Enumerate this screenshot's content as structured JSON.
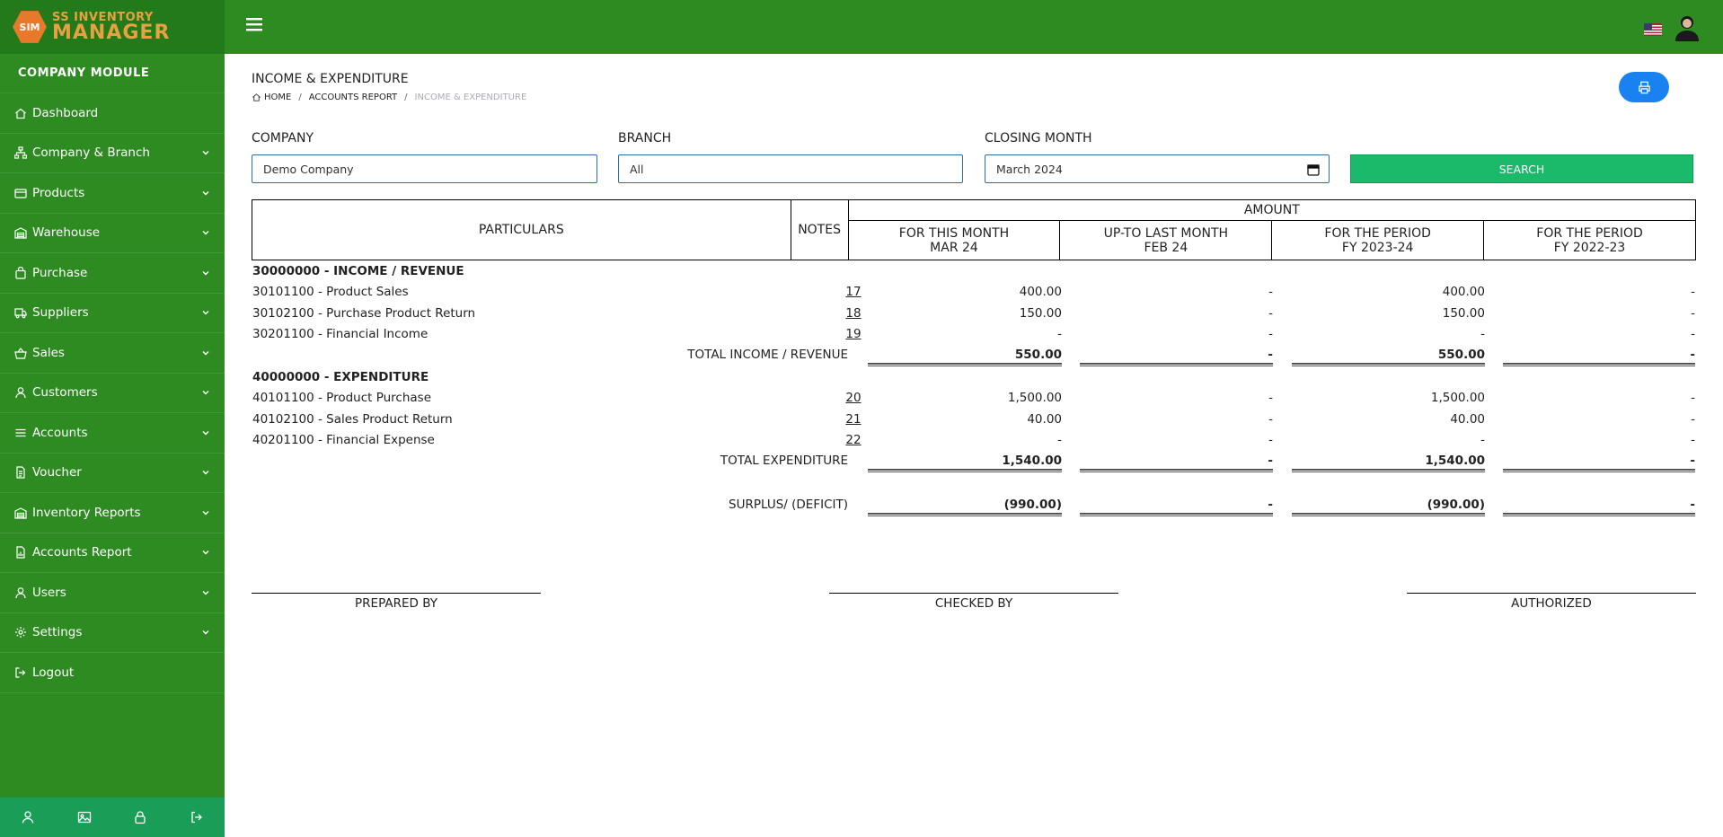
{
  "brand": {
    "logo_badge": "SIM",
    "line1": "SS INVENTORY",
    "line2": "MANAGER"
  },
  "sidebar": {
    "module_title": "COMPANY MODULE",
    "items": [
      {
        "label": "Dashboard",
        "icon": "home-icon",
        "chevron": false
      },
      {
        "label": "Company & Branch",
        "icon": "sitemap-icon",
        "chevron": true
      },
      {
        "label": "Products",
        "icon": "box-icon",
        "chevron": true
      },
      {
        "label": "Warehouse",
        "icon": "warehouse-icon",
        "chevron": true
      },
      {
        "label": "Purchase",
        "icon": "bag-icon",
        "chevron": true
      },
      {
        "label": "Suppliers",
        "icon": "truck-icon",
        "chevron": true
      },
      {
        "label": "Sales",
        "icon": "basket-icon",
        "chevron": true
      },
      {
        "label": "Customers",
        "icon": "user-icon",
        "chevron": true
      },
      {
        "label": "Accounts",
        "icon": "list-icon",
        "chevron": true
      },
      {
        "label": "Voucher",
        "icon": "file-icon",
        "chevron": true
      },
      {
        "label": "Inventory Reports",
        "icon": "warehouse-icon",
        "chevron": true
      },
      {
        "label": "Accounts Report",
        "icon": "file-report-icon",
        "chevron": true
      },
      {
        "label": "Users",
        "icon": "user-icon",
        "chevron": true
      },
      {
        "label": "Settings",
        "icon": "gear-icon",
        "chevron": true
      },
      {
        "label": "Logout",
        "icon": "logout-icon",
        "chevron": false
      }
    ],
    "footer_icons": [
      "user-icon",
      "image-icon",
      "lock-icon",
      "logout-icon"
    ]
  },
  "page": {
    "title": "INCOME & EXPENDITURE",
    "breadcrumb": {
      "home": "HOME",
      "parent": "ACCOUNTS REPORT",
      "current": "INCOME & EXPENDITURE"
    }
  },
  "filters": {
    "company_label": "COMPANY",
    "company_value": "Demo Company",
    "branch_label": "BRANCH",
    "branch_value": "All",
    "month_label": "CLOSING MONTH",
    "month_value": "March 2024",
    "search_label": "SEARCH"
  },
  "table": {
    "h_particulars": "PARTICULARS",
    "h_notes": "NOTES",
    "h_amount": "AMOUNT",
    "h_col1a": "FOR THIS MONTH",
    "h_col1b": "MAR 24",
    "h_col2a": "UP-TO LAST MONTH",
    "h_col2b": "FEB 24",
    "h_col3a": "FOR THE PERIOD",
    "h_col3b": "FY 2023-24",
    "h_col4a": "FOR THE PERIOD",
    "h_col4b": "FY 2022-23",
    "income_header": "30000000 - INCOME / REVENUE",
    "income_rows": [
      {
        "name": "30101100 - Product Sales",
        "note": "17",
        "v": [
          "400.00",
          "-",
          "400.00",
          "-"
        ]
      },
      {
        "name": "30102100 - Purchase Product Return",
        "note": "18",
        "v": [
          "150.00",
          "-",
          "150.00",
          "-"
        ]
      },
      {
        "name": "30201100 - Financial Income",
        "note": "19",
        "v": [
          "-",
          "-",
          "-",
          "-"
        ]
      }
    ],
    "income_total": {
      "label": "TOTAL INCOME / REVENUE",
      "v": [
        "550.00",
        "-",
        "550.00",
        "-"
      ]
    },
    "exp_header": "40000000 - EXPENDITURE",
    "exp_rows": [
      {
        "name": "40101100 - Product Purchase",
        "note": "20",
        "v": [
          "1,500.00",
          "-",
          "1,500.00",
          "-"
        ]
      },
      {
        "name": "40102100 - Sales Product Return",
        "note": "21",
        "v": [
          "40.00",
          "-",
          "40.00",
          "-"
        ]
      },
      {
        "name": "40201100 - Financial Expense",
        "note": "22",
        "v": [
          "-",
          "-",
          "-",
          "-"
        ]
      }
    ],
    "exp_total": {
      "label": "TOTAL EXPENDITURE",
      "v": [
        "1,540.00",
        "-",
        "1,540.00",
        "-"
      ]
    },
    "surplus": {
      "label": "SURPLUS/ (DEFICIT)",
      "v": [
        "(990.00)",
        "-",
        "(990.00)",
        "-"
      ]
    }
  },
  "signatures": {
    "prepared": "PREPARED BY",
    "checked": "CHECKED BY",
    "authorized": "AUTHORIZED"
  },
  "colors": {
    "sidebar": "#2e8b22",
    "topbar": "#2e8b22",
    "accent": "#1bba6b",
    "print": "#1a82f0"
  }
}
